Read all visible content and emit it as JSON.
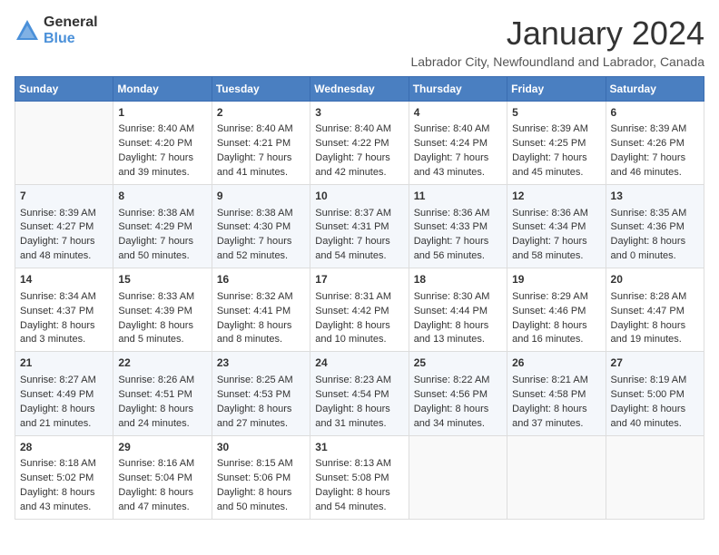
{
  "logo": {
    "general": "General",
    "blue": "Blue"
  },
  "title": "January 2024",
  "subtitle": "Labrador City, Newfoundland and Labrador, Canada",
  "days_header": [
    "Sunday",
    "Monday",
    "Tuesday",
    "Wednesday",
    "Thursday",
    "Friday",
    "Saturday"
  ],
  "weeks": [
    [
      {
        "day": "",
        "content": ""
      },
      {
        "day": "1",
        "content": "Sunrise: 8:40 AM\nSunset: 4:20 PM\nDaylight: 7 hours\nand 39 minutes."
      },
      {
        "day": "2",
        "content": "Sunrise: 8:40 AM\nSunset: 4:21 PM\nDaylight: 7 hours\nand 41 minutes."
      },
      {
        "day": "3",
        "content": "Sunrise: 8:40 AM\nSunset: 4:22 PM\nDaylight: 7 hours\nand 42 minutes."
      },
      {
        "day": "4",
        "content": "Sunrise: 8:40 AM\nSunset: 4:24 PM\nDaylight: 7 hours\nand 43 minutes."
      },
      {
        "day": "5",
        "content": "Sunrise: 8:39 AM\nSunset: 4:25 PM\nDaylight: 7 hours\nand 45 minutes."
      },
      {
        "day": "6",
        "content": "Sunrise: 8:39 AM\nSunset: 4:26 PM\nDaylight: 7 hours\nand 46 minutes."
      }
    ],
    [
      {
        "day": "7",
        "content": "Sunrise: 8:39 AM\nSunset: 4:27 PM\nDaylight: 7 hours\nand 48 minutes."
      },
      {
        "day": "8",
        "content": "Sunrise: 8:38 AM\nSunset: 4:29 PM\nDaylight: 7 hours\nand 50 minutes."
      },
      {
        "day": "9",
        "content": "Sunrise: 8:38 AM\nSunset: 4:30 PM\nDaylight: 7 hours\nand 52 minutes."
      },
      {
        "day": "10",
        "content": "Sunrise: 8:37 AM\nSunset: 4:31 PM\nDaylight: 7 hours\nand 54 minutes."
      },
      {
        "day": "11",
        "content": "Sunrise: 8:36 AM\nSunset: 4:33 PM\nDaylight: 7 hours\nand 56 minutes."
      },
      {
        "day": "12",
        "content": "Sunrise: 8:36 AM\nSunset: 4:34 PM\nDaylight: 7 hours\nand 58 minutes."
      },
      {
        "day": "13",
        "content": "Sunrise: 8:35 AM\nSunset: 4:36 PM\nDaylight: 8 hours\nand 0 minutes."
      }
    ],
    [
      {
        "day": "14",
        "content": "Sunrise: 8:34 AM\nSunset: 4:37 PM\nDaylight: 8 hours\nand 3 minutes."
      },
      {
        "day": "15",
        "content": "Sunrise: 8:33 AM\nSunset: 4:39 PM\nDaylight: 8 hours\nand 5 minutes."
      },
      {
        "day": "16",
        "content": "Sunrise: 8:32 AM\nSunset: 4:41 PM\nDaylight: 8 hours\nand 8 minutes."
      },
      {
        "day": "17",
        "content": "Sunrise: 8:31 AM\nSunset: 4:42 PM\nDaylight: 8 hours\nand 10 minutes."
      },
      {
        "day": "18",
        "content": "Sunrise: 8:30 AM\nSunset: 4:44 PM\nDaylight: 8 hours\nand 13 minutes."
      },
      {
        "day": "19",
        "content": "Sunrise: 8:29 AM\nSunset: 4:46 PM\nDaylight: 8 hours\nand 16 minutes."
      },
      {
        "day": "20",
        "content": "Sunrise: 8:28 AM\nSunset: 4:47 PM\nDaylight: 8 hours\nand 19 minutes."
      }
    ],
    [
      {
        "day": "21",
        "content": "Sunrise: 8:27 AM\nSunset: 4:49 PM\nDaylight: 8 hours\nand 21 minutes."
      },
      {
        "day": "22",
        "content": "Sunrise: 8:26 AM\nSunset: 4:51 PM\nDaylight: 8 hours\nand 24 minutes."
      },
      {
        "day": "23",
        "content": "Sunrise: 8:25 AM\nSunset: 4:53 PM\nDaylight: 8 hours\nand 27 minutes."
      },
      {
        "day": "24",
        "content": "Sunrise: 8:23 AM\nSunset: 4:54 PM\nDaylight: 8 hours\nand 31 minutes."
      },
      {
        "day": "25",
        "content": "Sunrise: 8:22 AM\nSunset: 4:56 PM\nDaylight: 8 hours\nand 34 minutes."
      },
      {
        "day": "26",
        "content": "Sunrise: 8:21 AM\nSunset: 4:58 PM\nDaylight: 8 hours\nand 37 minutes."
      },
      {
        "day": "27",
        "content": "Sunrise: 8:19 AM\nSunset: 5:00 PM\nDaylight: 8 hours\nand 40 minutes."
      }
    ],
    [
      {
        "day": "28",
        "content": "Sunrise: 8:18 AM\nSunset: 5:02 PM\nDaylight: 8 hours\nand 43 minutes."
      },
      {
        "day": "29",
        "content": "Sunrise: 8:16 AM\nSunset: 5:04 PM\nDaylight: 8 hours\nand 47 minutes."
      },
      {
        "day": "30",
        "content": "Sunrise: 8:15 AM\nSunset: 5:06 PM\nDaylight: 8 hours\nand 50 minutes."
      },
      {
        "day": "31",
        "content": "Sunrise: 8:13 AM\nSunset: 5:08 PM\nDaylight: 8 hours\nand 54 minutes."
      },
      {
        "day": "",
        "content": ""
      },
      {
        "day": "",
        "content": ""
      },
      {
        "day": "",
        "content": ""
      }
    ]
  ]
}
